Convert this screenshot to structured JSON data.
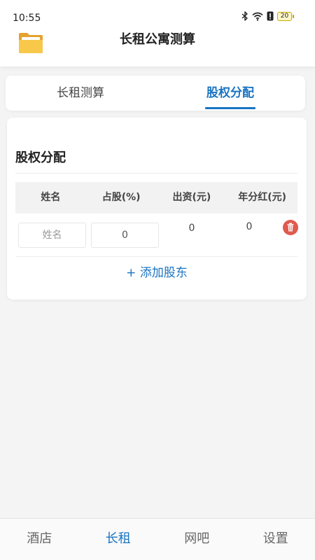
{
  "status_bar": {
    "time": "10:55",
    "battery": "20",
    "icons": [
      "bluetooth-icon",
      "wifi-icon",
      "alert-icon",
      "battery-icon"
    ]
  },
  "header": {
    "title": "长租公寓测算",
    "icon": "folder-icon"
  },
  "tabs": [
    {
      "label": "长租测算",
      "active": false
    },
    {
      "label": "股权分配",
      "active": true
    }
  ],
  "equity": {
    "title": "股权分配",
    "table": {
      "headers": [
        "姓名",
        "占股(%)",
        "出资(元)",
        "年分红(元)"
      ],
      "rows": [
        {
          "name_placeholder": "姓名",
          "share_value": "0",
          "investment": "0",
          "dividend": "0",
          "delete_icon": "trash-icon"
        }
      ]
    },
    "add_label": "+ 添加股东"
  },
  "bottom_nav": [
    {
      "label": "酒店",
      "active": false
    },
    {
      "label": "长租",
      "active": true
    },
    {
      "label": "网吧",
      "active": false
    },
    {
      "label": "设置",
      "active": false
    }
  ],
  "colors": {
    "accent": "#1a74c2",
    "danger": "#e05a4e",
    "page_background": "#f4f4f4"
  }
}
